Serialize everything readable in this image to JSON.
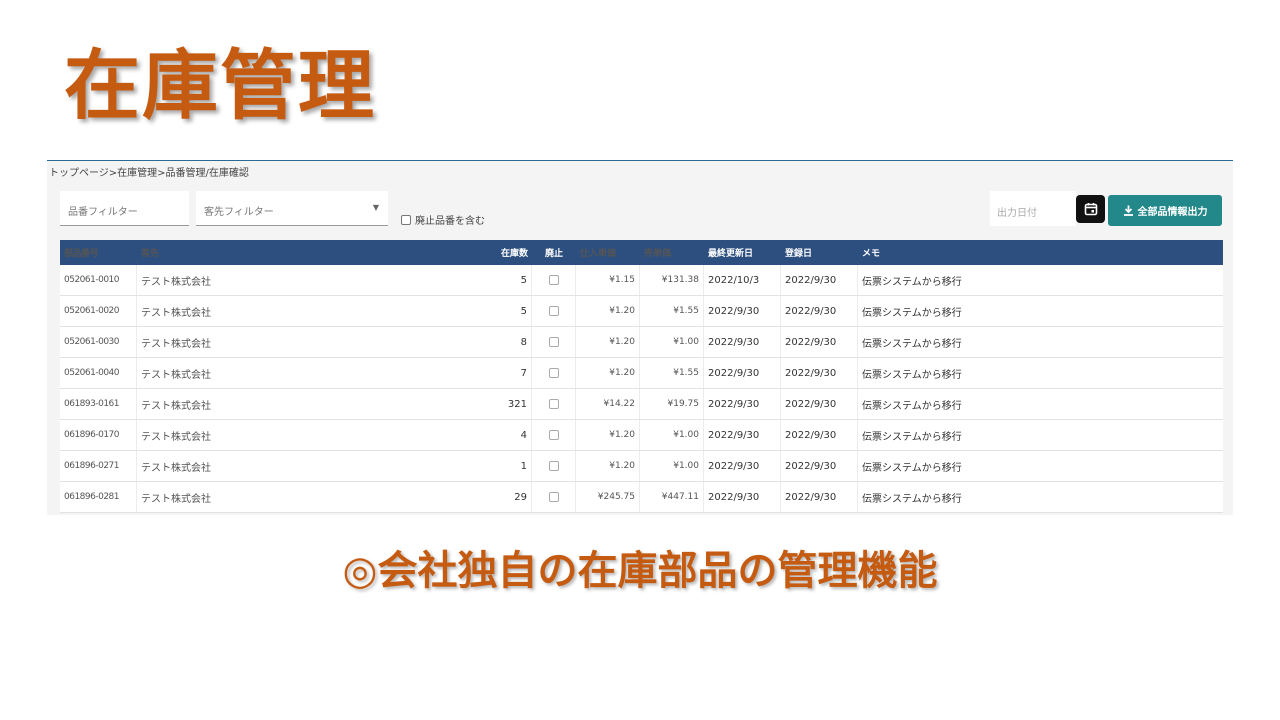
{
  "slide": {
    "title": "在庫管理",
    "caption": "◎会社独自の在庫部品の管理機能"
  },
  "app": {
    "breadcrumb": "トップページ>在庫管理>品番管理/在庫確認",
    "filters": {
      "part_placeholder": "品番フィルター",
      "client_placeholder": "客先フィルター",
      "include_discontinued_label": "廃止品番を含む"
    },
    "output_date_placeholder": "出力日付",
    "export_label": "全部品情報出力",
    "icons": {
      "calendar": "calendar-icon",
      "download": "download-icon",
      "dropdown": "chevron-down-icon"
    },
    "colors": {
      "header": "#2d4f7f",
      "export_button": "#23888a",
      "accent": "#c55a11"
    }
  },
  "table": {
    "columns": [
      "部品番号",
      "客先",
      "在庫数",
      "廃止",
      "仕入単価",
      "売単価",
      "最終更新日",
      "登録日",
      "メモ"
    ],
    "rows": [
      {
        "part": "052061-0010",
        "client": "テスト株式会社",
        "stock": "5",
        "cost": "¥1.15",
        "sale": "¥131.38",
        "updated": "2022/10/3",
        "registered": "2022/9/30",
        "memo": "伝票システムから移行"
      },
      {
        "part": "052061-0020",
        "client": "テスト株式会社",
        "stock": "5",
        "cost": "¥1.20",
        "sale": "¥1.55",
        "updated": "2022/9/30",
        "registered": "2022/9/30",
        "memo": "伝票システムから移行"
      },
      {
        "part": "052061-0030",
        "client": "テスト株式会社",
        "stock": "8",
        "cost": "¥1.20",
        "sale": "¥1.00",
        "updated": "2022/9/30",
        "registered": "2022/9/30",
        "memo": "伝票システムから移行"
      },
      {
        "part": "052061-0040",
        "client": "テスト株式会社",
        "stock": "7",
        "cost": "¥1.20",
        "sale": "¥1.55",
        "updated": "2022/9/30",
        "registered": "2022/9/30",
        "memo": "伝票システムから移行"
      },
      {
        "part": "061893-0161",
        "client": "テスト株式会社",
        "stock": "321",
        "cost": "¥14.22",
        "sale": "¥19.75",
        "updated": "2022/9/30",
        "registered": "2022/9/30",
        "memo": "伝票システムから移行"
      },
      {
        "part": "061896-0170",
        "client": "テスト株式会社",
        "stock": "4",
        "cost": "¥1.20",
        "sale": "¥1.00",
        "updated": "2022/9/30",
        "registered": "2022/9/30",
        "memo": "伝票システムから移行"
      },
      {
        "part": "061896-0271",
        "client": "テスト株式会社",
        "stock": "1",
        "cost": "¥1.20",
        "sale": "¥1.00",
        "updated": "2022/9/30",
        "registered": "2022/9/30",
        "memo": "伝票システムから移行"
      },
      {
        "part": "061896-0281",
        "client": "テスト株式会社",
        "stock": "29",
        "cost": "¥245.75",
        "sale": "¥447.11",
        "updated": "2022/9/30",
        "registered": "2022/9/30",
        "memo": "伝票システムから移行"
      }
    ]
  }
}
